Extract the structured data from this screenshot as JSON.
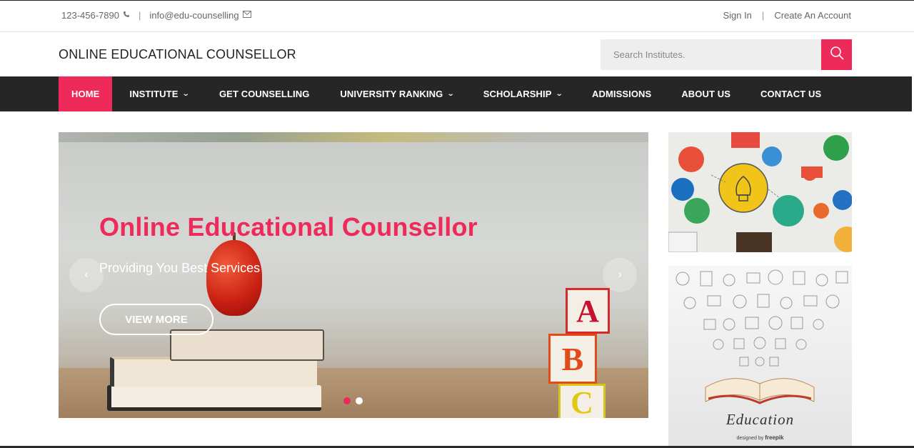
{
  "topbar": {
    "phone": "123-456-7890",
    "email": "info@edu-counselling",
    "sign_in": "Sign In",
    "create_account": "Create An Account"
  },
  "header": {
    "brand": "ONLINE EDUCATIONAL COUNSELLOR",
    "search_placeholder": "Search Institutes."
  },
  "nav": {
    "items": [
      {
        "label": "HOME",
        "dropdown": false,
        "active": true
      },
      {
        "label": "INSTITUTE",
        "dropdown": true
      },
      {
        "label": "GET COUNSELLING",
        "dropdown": false
      },
      {
        "label": "UNIVERSITY RANKING",
        "dropdown": true
      },
      {
        "label": "SCHOLARSHIP",
        "dropdown": true
      },
      {
        "label": "ADMISSIONS",
        "dropdown": false
      },
      {
        "label": "ABOUT US",
        "dropdown": false
      },
      {
        "label": "CONTACT US",
        "dropdown": false
      }
    ]
  },
  "slider": {
    "title": "Online Educational Counsellor",
    "subtitle": "Providing You Best Services",
    "button": "VIEW MORE",
    "block_letters": [
      "A",
      "B",
      "C"
    ],
    "slide_count": 2,
    "active_slide": 1
  },
  "side_images": {
    "bottom_word": "Education",
    "bottom_credit_prefix": "designed by",
    "bottom_credit_brand": "freepik"
  },
  "colors": {
    "accent": "#ee2a5b",
    "nav_bg": "#262626",
    "search_bg": "#eeeeee"
  },
  "icons": {
    "phone": "phone-icon",
    "email": "envelope-icon",
    "search": "search-icon",
    "prev": "chevron-left-icon",
    "next": "chevron-right-icon",
    "dropdown": "chevron-down-icon"
  }
}
